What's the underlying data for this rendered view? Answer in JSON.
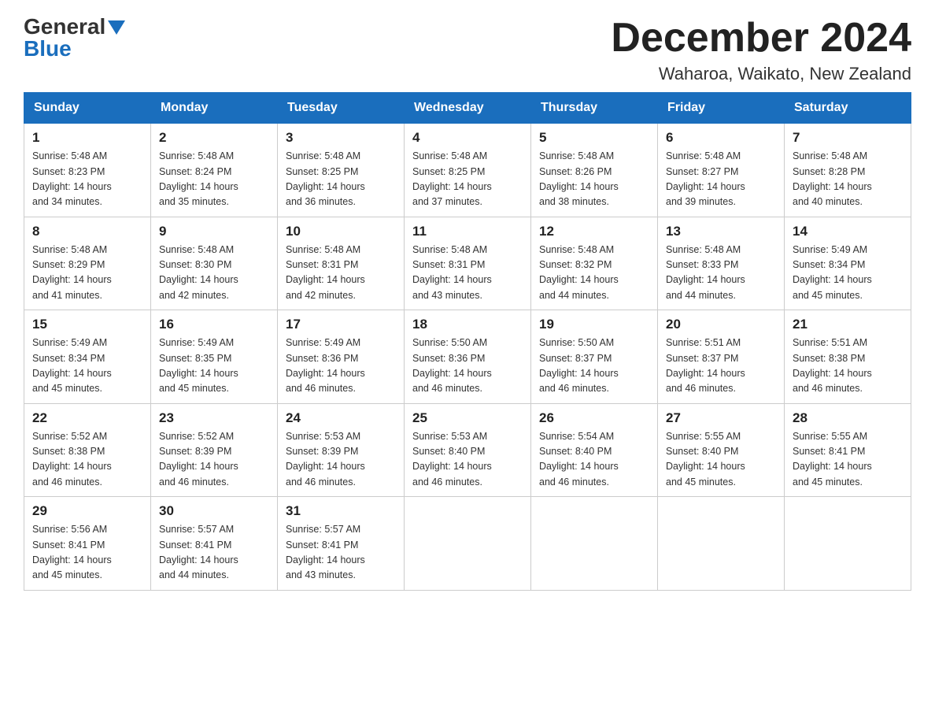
{
  "header": {
    "logo_general": "General",
    "logo_blue": "Blue",
    "title": "December 2024",
    "subtitle": "Waharoa, Waikato, New Zealand"
  },
  "weekdays": [
    "Sunday",
    "Monday",
    "Tuesday",
    "Wednesday",
    "Thursday",
    "Friday",
    "Saturday"
  ],
  "weeks": [
    [
      {
        "day": "1",
        "sunrise": "5:48 AM",
        "sunset": "8:23 PM",
        "daylight": "14 hours and 34 minutes."
      },
      {
        "day": "2",
        "sunrise": "5:48 AM",
        "sunset": "8:24 PM",
        "daylight": "14 hours and 35 minutes."
      },
      {
        "day": "3",
        "sunrise": "5:48 AM",
        "sunset": "8:25 PM",
        "daylight": "14 hours and 36 minutes."
      },
      {
        "day": "4",
        "sunrise": "5:48 AM",
        "sunset": "8:25 PM",
        "daylight": "14 hours and 37 minutes."
      },
      {
        "day": "5",
        "sunrise": "5:48 AM",
        "sunset": "8:26 PM",
        "daylight": "14 hours and 38 minutes."
      },
      {
        "day": "6",
        "sunrise": "5:48 AM",
        "sunset": "8:27 PM",
        "daylight": "14 hours and 39 minutes."
      },
      {
        "day": "7",
        "sunrise": "5:48 AM",
        "sunset": "8:28 PM",
        "daylight": "14 hours and 40 minutes."
      }
    ],
    [
      {
        "day": "8",
        "sunrise": "5:48 AM",
        "sunset": "8:29 PM",
        "daylight": "14 hours and 41 minutes."
      },
      {
        "day": "9",
        "sunrise": "5:48 AM",
        "sunset": "8:30 PM",
        "daylight": "14 hours and 42 minutes."
      },
      {
        "day": "10",
        "sunrise": "5:48 AM",
        "sunset": "8:31 PM",
        "daylight": "14 hours and 42 minutes."
      },
      {
        "day": "11",
        "sunrise": "5:48 AM",
        "sunset": "8:31 PM",
        "daylight": "14 hours and 43 minutes."
      },
      {
        "day": "12",
        "sunrise": "5:48 AM",
        "sunset": "8:32 PM",
        "daylight": "14 hours and 44 minutes."
      },
      {
        "day": "13",
        "sunrise": "5:48 AM",
        "sunset": "8:33 PM",
        "daylight": "14 hours and 44 minutes."
      },
      {
        "day": "14",
        "sunrise": "5:49 AM",
        "sunset": "8:34 PM",
        "daylight": "14 hours and 45 minutes."
      }
    ],
    [
      {
        "day": "15",
        "sunrise": "5:49 AM",
        "sunset": "8:34 PM",
        "daylight": "14 hours and 45 minutes."
      },
      {
        "day": "16",
        "sunrise": "5:49 AM",
        "sunset": "8:35 PM",
        "daylight": "14 hours and 45 minutes."
      },
      {
        "day": "17",
        "sunrise": "5:49 AM",
        "sunset": "8:36 PM",
        "daylight": "14 hours and 46 minutes."
      },
      {
        "day": "18",
        "sunrise": "5:50 AM",
        "sunset": "8:36 PM",
        "daylight": "14 hours and 46 minutes."
      },
      {
        "day": "19",
        "sunrise": "5:50 AM",
        "sunset": "8:37 PM",
        "daylight": "14 hours and 46 minutes."
      },
      {
        "day": "20",
        "sunrise": "5:51 AM",
        "sunset": "8:37 PM",
        "daylight": "14 hours and 46 minutes."
      },
      {
        "day": "21",
        "sunrise": "5:51 AM",
        "sunset": "8:38 PM",
        "daylight": "14 hours and 46 minutes."
      }
    ],
    [
      {
        "day": "22",
        "sunrise": "5:52 AM",
        "sunset": "8:38 PM",
        "daylight": "14 hours and 46 minutes."
      },
      {
        "day": "23",
        "sunrise": "5:52 AM",
        "sunset": "8:39 PM",
        "daylight": "14 hours and 46 minutes."
      },
      {
        "day": "24",
        "sunrise": "5:53 AM",
        "sunset": "8:39 PM",
        "daylight": "14 hours and 46 minutes."
      },
      {
        "day": "25",
        "sunrise": "5:53 AM",
        "sunset": "8:40 PM",
        "daylight": "14 hours and 46 minutes."
      },
      {
        "day": "26",
        "sunrise": "5:54 AM",
        "sunset": "8:40 PM",
        "daylight": "14 hours and 46 minutes."
      },
      {
        "day": "27",
        "sunrise": "5:55 AM",
        "sunset": "8:40 PM",
        "daylight": "14 hours and 45 minutes."
      },
      {
        "day": "28",
        "sunrise": "5:55 AM",
        "sunset": "8:41 PM",
        "daylight": "14 hours and 45 minutes."
      }
    ],
    [
      {
        "day": "29",
        "sunrise": "5:56 AM",
        "sunset": "8:41 PM",
        "daylight": "14 hours and 45 minutes."
      },
      {
        "day": "30",
        "sunrise": "5:57 AM",
        "sunset": "8:41 PM",
        "daylight": "14 hours and 44 minutes."
      },
      {
        "day": "31",
        "sunrise": "5:57 AM",
        "sunset": "8:41 PM",
        "daylight": "14 hours and 43 minutes."
      },
      null,
      null,
      null,
      null
    ]
  ],
  "labels": {
    "sunrise": "Sunrise:",
    "sunset": "Sunset:",
    "daylight": "Daylight:"
  }
}
